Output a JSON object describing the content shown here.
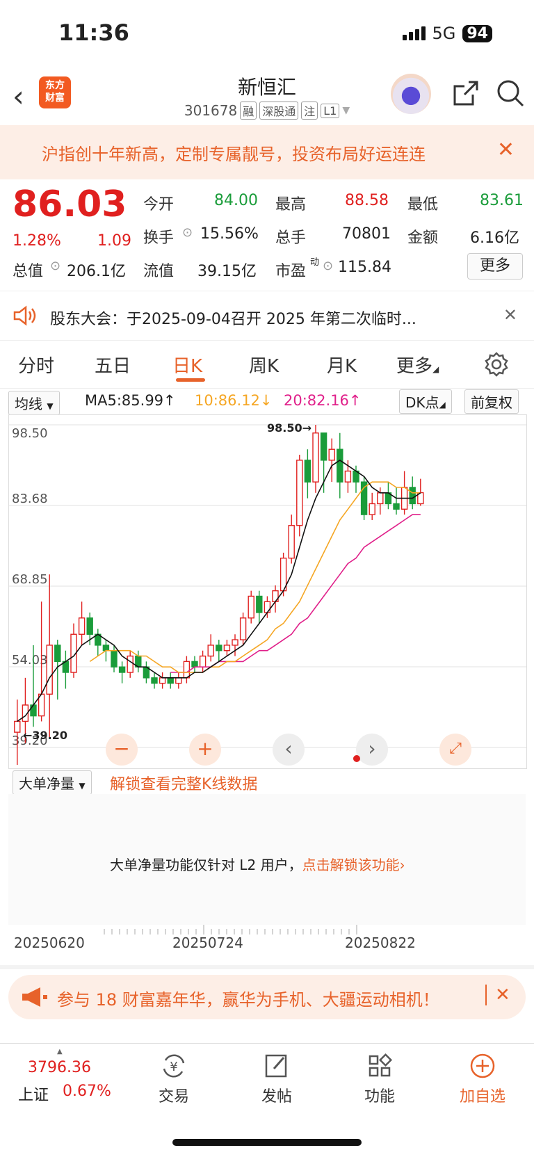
{
  "status": {
    "time": "11:36",
    "network": "5G",
    "battery": "94"
  },
  "header": {
    "logo_text_1": "东方",
    "logo_text_2": "财富",
    "name": "新恒汇",
    "code": "301678",
    "tags": [
      "融",
      "深股通",
      "注",
      "L1"
    ]
  },
  "banner": {
    "text": "沪指创十年新高，定制专属靓号，投资布局好运连连"
  },
  "quote": {
    "price": "86.03",
    "change_pct": "1.28%",
    "change": "1.09",
    "open_label": "今开",
    "open": "84.00",
    "high_label": "最高",
    "high": "88.58",
    "low_label": "最低",
    "low": "83.61",
    "turnover_label": "换手",
    "turnover": "15.56%",
    "volume_label": "总手",
    "volume": "70801",
    "amount_label": "金额",
    "amount": "6.16亿",
    "mktcap_label": "总值",
    "mktcap": "206.1亿",
    "float_label": "流值",
    "float": "39.15亿",
    "pe_label": "市盈",
    "pe_sup": "动",
    "pe": "115.84",
    "more": "更多"
  },
  "notice": {
    "text": "股东大会：于2025-09-04召开 2025 年第二次临时..."
  },
  "tabs": [
    "分时",
    "五日",
    "日K",
    "周K",
    "月K",
    "更多"
  ],
  "active_tab": 2,
  "ma": {
    "type": "均线",
    "ma5": "MA5:85.99↑",
    "ma10": "10:86.12↓",
    "ma20": "20:82.16↑",
    "dk": "DK点",
    "adjust": "前复权",
    "colors": {
      "ma5": "#111111",
      "ma10": "#f5a623",
      "ma20": "#e0208a"
    }
  },
  "chart_data": {
    "type": "candlestick",
    "y_ticks": [
      "98.50",
      "83.68",
      "68.85",
      "54.03",
      "39.20"
    ],
    "ylim": [
      39.2,
      98.5
    ],
    "max_marker": "98.50→",
    "min_marker": "←39.20",
    "colors": {
      "up": "#e0201f",
      "down": "#1a9c3a"
    },
    "candles": [
      [
        42,
        44,
        36,
        48
      ],
      [
        44,
        47,
        40,
        52
      ],
      [
        47,
        45,
        43,
        58
      ],
      [
        45,
        49,
        44,
        66
      ],
      [
        49,
        58,
        41,
        71
      ],
      [
        58,
        55,
        48,
        59
      ],
      [
        55,
        53,
        50,
        57
      ],
      [
        53,
        60,
        52,
        62
      ],
      [
        60,
        63,
        58,
        66
      ],
      [
        63,
        60,
        58,
        64
      ],
      [
        60,
        58,
        56,
        61
      ],
      [
        58,
        57,
        55,
        59
      ],
      [
        57,
        54,
        53,
        58
      ],
      [
        54,
        53,
        51,
        55
      ],
      [
        53,
        56,
        52,
        57
      ],
      [
        56,
        54,
        53,
        57
      ],
      [
        54,
        52,
        51,
        55
      ],
      [
        52,
        51,
        50,
        53
      ],
      [
        51,
        52,
        50,
        53
      ],
      [
        52,
        51,
        50,
        53
      ],
      [
        51,
        52,
        50,
        53
      ],
      [
        52,
        55,
        51,
        56
      ],
      [
        55,
        54,
        53,
        56
      ],
      [
        54,
        56,
        53,
        57
      ],
      [
        56,
        58,
        55,
        60
      ],
      [
        58,
        57,
        55,
        59
      ],
      [
        57,
        58,
        56,
        59
      ],
      [
        58,
        59,
        56,
        60
      ],
      [
        59,
        63,
        58,
        64
      ],
      [
        63,
        67,
        62,
        68
      ],
      [
        67,
        64,
        62,
        68
      ],
      [
        64,
        66,
        63,
        67
      ],
      [
        66,
        68,
        64,
        69
      ],
      [
        68,
        74,
        67,
        75
      ],
      [
        74,
        80,
        73,
        82
      ],
      [
        80,
        92,
        78,
        93
      ],
      [
        92,
        88,
        85,
        94
      ],
      [
        88,
        97,
        86,
        98.5
      ],
      [
        97,
        92,
        86,
        97
      ],
      [
        92,
        94,
        88,
        96
      ],
      [
        94,
        88,
        85,
        97
      ],
      [
        88,
        90,
        86,
        92
      ],
      [
        90,
        88,
        86,
        91
      ],
      [
        88,
        82,
        81,
        89
      ],
      [
        82,
        84,
        81,
        86
      ],
      [
        84,
        86,
        82,
        87
      ],
      [
        86,
        84,
        83,
        88
      ],
      [
        84,
        83,
        82,
        87
      ],
      [
        83,
        87,
        82,
        90
      ],
      [
        87,
        84,
        83,
        89
      ],
      [
        84,
        86.03,
        83.61,
        88.58
      ]
    ],
    "ma5": [
      44,
      45,
      47,
      49,
      52,
      54,
      55,
      56,
      58,
      59,
      60,
      59,
      58,
      56,
      55,
      54,
      54,
      53,
      52,
      52,
      52,
      52,
      53,
      53,
      54,
      55,
      56,
      57,
      58,
      60,
      62,
      64,
      66,
      68,
      71,
      76,
      81,
      85,
      88,
      91,
      92,
      91,
      90,
      89,
      87,
      86,
      86,
      85,
      85,
      85,
      86
    ],
    "ma10": [
      null,
      null,
      null,
      null,
      null,
      null,
      null,
      null,
      null,
      55,
      56,
      57,
      57,
      57,
      57,
      56,
      56,
      55,
      54,
      54,
      53,
      53,
      53,
      53,
      54,
      54,
      55,
      55,
      56,
      57,
      58,
      59,
      61,
      62,
      64,
      66,
      69,
      72,
      75,
      78,
      81,
      83,
      85,
      87,
      88,
      88,
      88,
      87,
      87,
      86,
      86
    ],
    "ma20": [
      null,
      null,
      null,
      null,
      null,
      null,
      null,
      null,
      null,
      null,
      null,
      null,
      null,
      null,
      null,
      null,
      null,
      null,
      null,
      53,
      53,
      53,
      54,
      54,
      54,
      55,
      55,
      55,
      55,
      56,
      57,
      57,
      58,
      59,
      60,
      62,
      63,
      65,
      67,
      69,
      71,
      73,
      74,
      76,
      77,
      78,
      79,
      80,
      81,
      82,
      82
    ]
  },
  "controls": [
    "back",
    "zoom-out",
    "zoom-in",
    "prev",
    "next",
    "expand"
  ],
  "volume": {
    "type": "大单净量",
    "unlock": "解锁查看完整K线数据",
    "message": "大单净量功能仅针对 L2 用户，",
    "link": "点击解锁该功能",
    "dates": [
      "20250620",
      "20250724",
      "20250822"
    ]
  },
  "promo": {
    "text": "参与 18 财富嘉年华，赢华为手机、大疆运动相机！"
  },
  "bottom_nav": {
    "index_value": "3796.36",
    "index_name": "上证",
    "index_pct": "0.67%",
    "items": [
      "交易",
      "发帖",
      "功能",
      "加自选"
    ]
  }
}
